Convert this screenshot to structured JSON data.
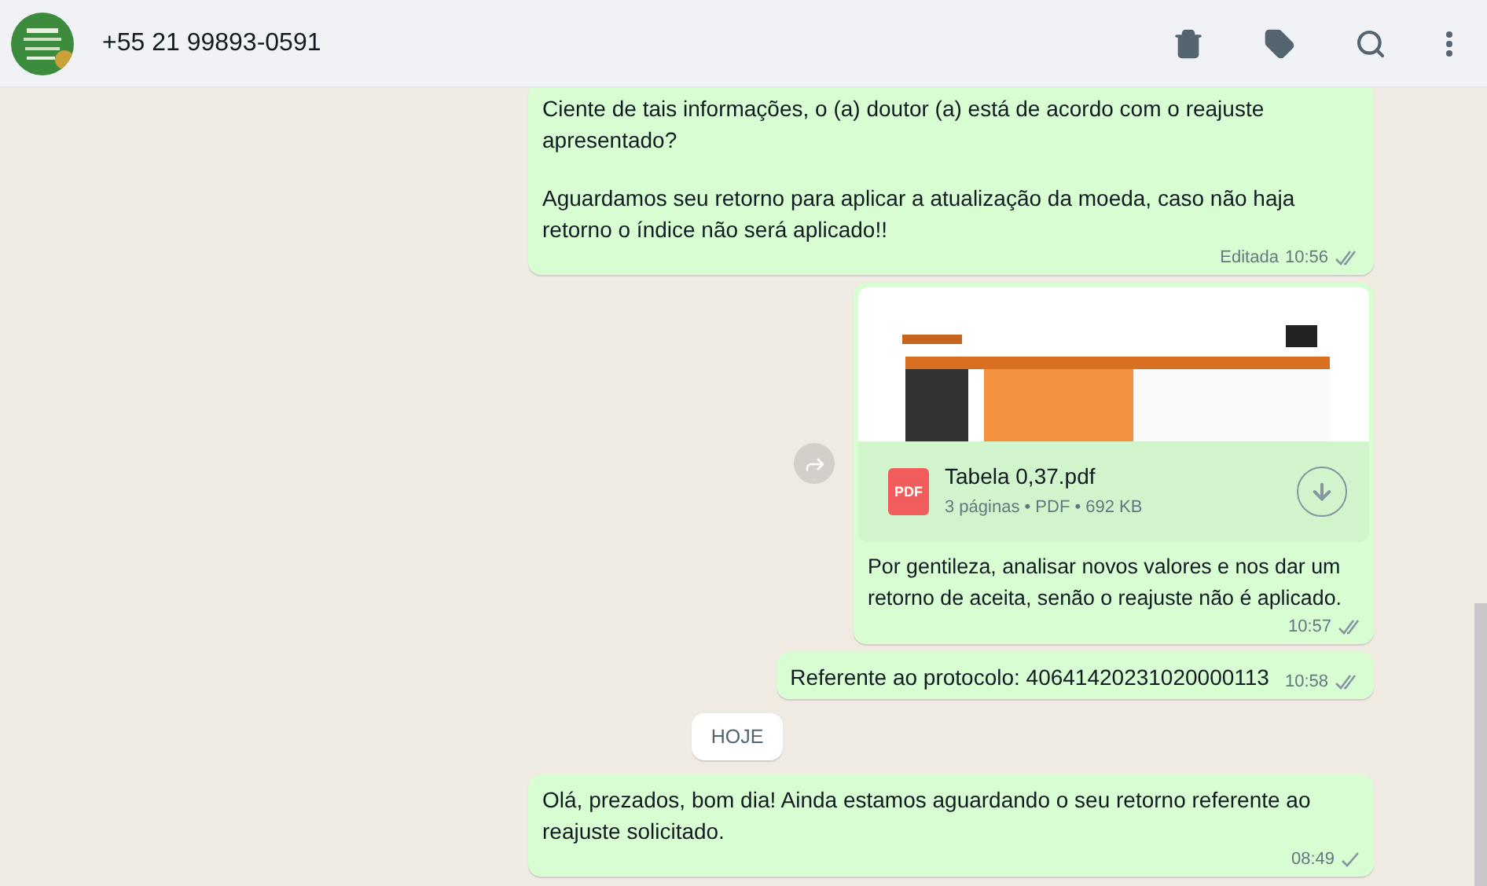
{
  "header": {
    "contact": "+55 21 99893-0591"
  },
  "messages": [
    {
      "kind": "text",
      "paragraphs": [
        "Ciente de tais informações, o (a) doutor (a) está de acordo com o reajuste apresentado?",
        "Aguardamos seu retorno para aplicar a atualização da moeda, caso não haja retorno o índice não será aplicado!!"
      ],
      "edited": "Editada",
      "time": "10:56",
      "delivered": true
    },
    {
      "kind": "document",
      "forward": true,
      "file_name": "Tabela 0,37.pdf",
      "file_icon": "PDF",
      "file_meta": "3 páginas • PDF • 692 KB",
      "caption": "Por gentileza, analisar novos valores e nos dar um retorno de aceita, senão o reajuste não é aplicado.",
      "time": "10:57",
      "delivered": true
    },
    {
      "kind": "text",
      "paragraphs": [
        "Referente ao protocolo: 40641420231020000113"
      ],
      "time": "10:58",
      "delivered": true
    },
    {
      "kind": "date",
      "label": "HOJE"
    },
    {
      "kind": "text",
      "paragraphs": [
        "Olá, prezados, bom dia! Ainda estamos aguardando o seu retorno referente ao reajuste solicitado."
      ],
      "time": "08:49",
      "delivered": false
    }
  ]
}
